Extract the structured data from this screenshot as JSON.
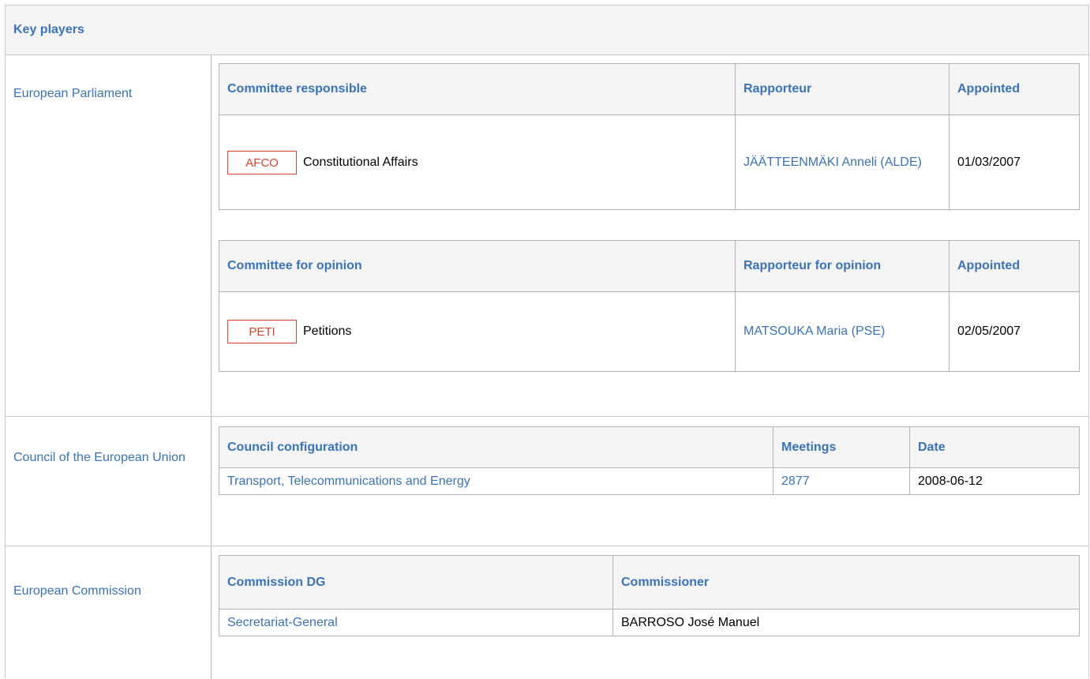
{
  "header": {
    "title": "Key players"
  },
  "ep": {
    "label": "European Parliament",
    "responsible": {
      "headers": [
        "Committee responsible",
        "Rapporteur",
        "Appointed"
      ],
      "abbr": "AFCO",
      "committee": "Constitutional Affairs",
      "rapporteur": "JÄÄTTEENMÄKI Anneli (ALDE)",
      "appointed": "01/03/2007"
    },
    "opinion": {
      "headers": [
        "Committee for opinion",
        "Rapporteur for opinion",
        "Appointed"
      ],
      "abbr": "PETI",
      "committee": "Petitions",
      "rapporteur": "MATSOUKA Maria (PSE)",
      "appointed": "02/05/2007"
    }
  },
  "council": {
    "label": "Council of the European Union",
    "headers": [
      "Council configuration",
      "Meetings",
      "Date"
    ],
    "configuration": "Transport, Telecommunications and Energy",
    "meeting": "2877",
    "date": "2008-06-12"
  },
  "commission": {
    "label": "European Commission",
    "headers": [
      "Commission DG",
      "Commissioner"
    ],
    "dg": "Secretariat-General",
    "commissioner": "BARROSO José Manuel"
  },
  "colors": {
    "link": "#3a73b8",
    "badge": "#d9442b",
    "header_bg": "#f4f4f4"
  }
}
